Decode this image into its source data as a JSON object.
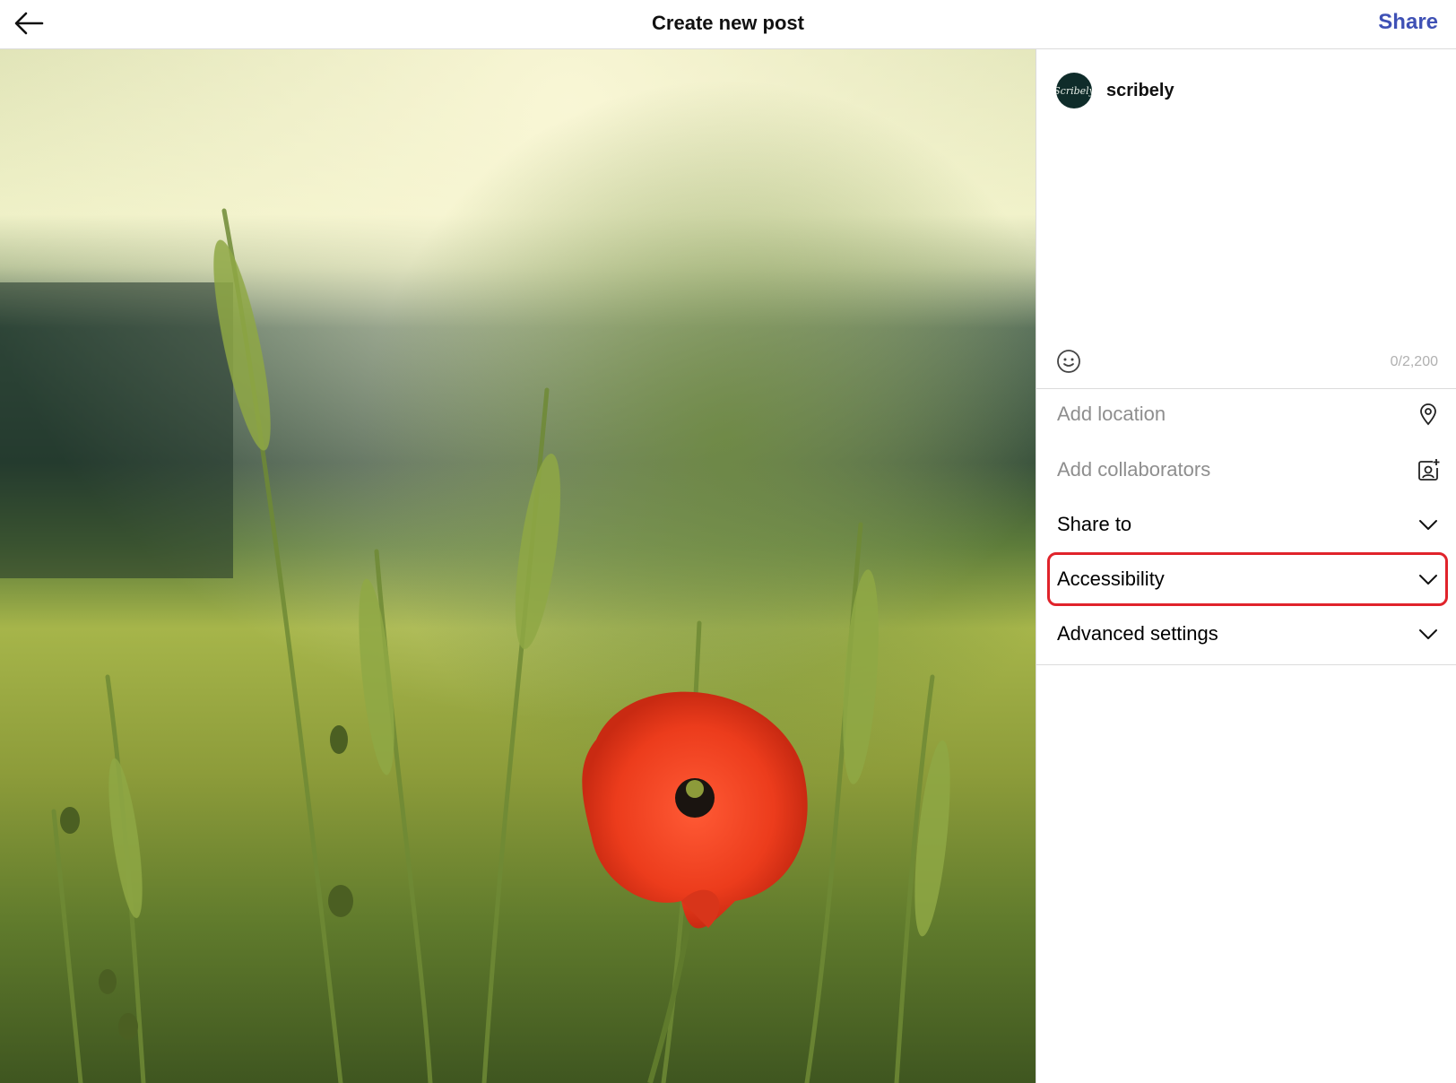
{
  "header": {
    "title": "Create new post",
    "share_label": "Share",
    "share_color": "#3f51b5"
  },
  "account": {
    "username": "scribely",
    "avatar_text": "Scribely"
  },
  "caption": {
    "value": "",
    "char_count": "0/2,200"
  },
  "options": {
    "add_location": "Add location",
    "add_collaborators": "Add collaborators",
    "share_to": "Share to",
    "accessibility": "Accessibility",
    "advanced_settings": "Advanced settings"
  },
  "icons": {
    "back": "arrow-left-icon",
    "emoji": "smiley-icon",
    "location": "map-pin-icon",
    "collaborators": "add-person-icon",
    "expand": "chevron-down-icon"
  },
  "highlight_color": "#e0232b",
  "photo": {
    "description_colors": {
      "sky": "#e9ecc0",
      "hills": "#2f4a3a",
      "field": "#9aa83e",
      "poppy": "#e8391f"
    }
  }
}
